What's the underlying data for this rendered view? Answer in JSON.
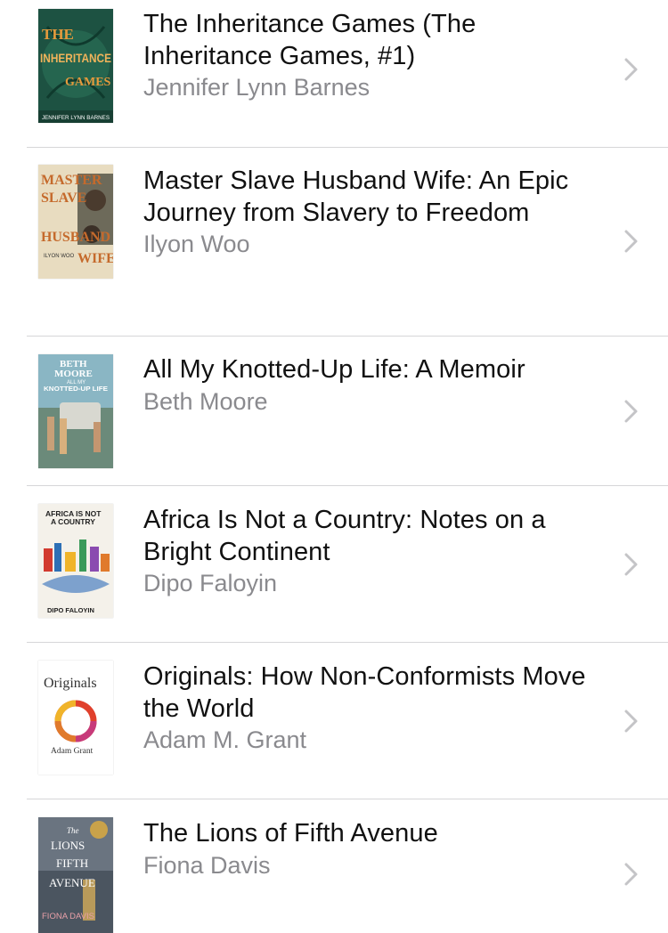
{
  "books": [
    {
      "title": "The Inheritance Games (The Inheritance Games, #1)",
      "author": "Jennifer Lynn Barnes",
      "cover": {
        "text": [
          "THE",
          "INHERITANCE",
          "GAMES",
          "JENNIFER LYNN BARNES"
        ],
        "bg": "#1f5a46",
        "accent": "#e59a3c"
      }
    },
    {
      "title": "Master Slave Husband Wife: An Epic Journey from Slavery to Freedom",
      "author": "Ilyon Woo",
      "cover": {
        "text": [
          "MASTER",
          "SLAVE",
          "HUSBAND",
          "WIFE",
          "ILYON WOO"
        ],
        "bg": "#e8dcc0",
        "accent": "#c56a2c"
      }
    },
    {
      "title": "All My Knotted-Up Life: A Memoir",
      "author": "Beth Moore",
      "cover": {
        "text": [
          "BETH",
          "MOORE",
          "ALL MY",
          "KNOTTED-UP LIFE"
        ],
        "bg": "#5f8fa4",
        "accent": "#ffffff"
      }
    },
    {
      "title": "Africa Is Not a Country: Notes on a Bright Continent",
      "author": "Dipo Faloyin",
      "cover": {
        "text": [
          "AFRICA IS NOT",
          "A COUNTRY",
          "DIPO FALOYIN"
        ],
        "bg": "#f4f1ea",
        "accent": "#d23a2f"
      }
    },
    {
      "title": "Originals: How Non-Conformists Move the World",
      "author": "Adam M. Grant",
      "cover": {
        "text": [
          "Originals",
          "Adam Grant"
        ],
        "bg": "#ffffff",
        "accent": "#e0402c"
      }
    },
    {
      "title": "The Lions of Fifth Avenue",
      "author": "Fiona Davis",
      "cover": {
        "text": [
          "The",
          "LIONS",
          "FIFTH",
          "AVENUE",
          "FIONA DAVIS"
        ],
        "bg": "#4b5560",
        "accent": "#c9a24a"
      }
    }
  ],
  "chevron_icon": "chevron-right-icon"
}
